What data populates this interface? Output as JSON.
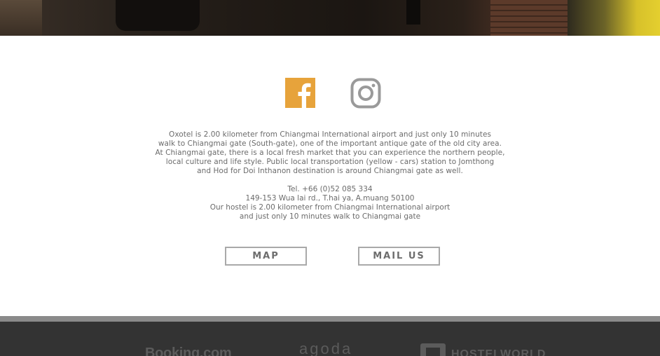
{
  "social": {
    "facebook_icon": "facebook-icon",
    "instagram_icon": "instagram-icon",
    "brand_color": "#e7a33b",
    "instagram_color": "#9a9a9a"
  },
  "description": {
    "lines": [
      "Oxotel is 2.00 kilometer from Chiangmai International airport and just only 10 minutes",
      "walk to Chiangmai gate (South-gate), one of the important antique gate of the old city area.",
      "At Chiangmai gate, there is a local fresh market that you can experience the northern people,",
      "local culture and life style. Public local transportation (yellow - cars) station to Jomthong",
      "and Hod for Doi Inthanon destination is around Chiangmai gate as well."
    ]
  },
  "contact": {
    "tel": "Tel. +66 (0)52 085 334",
    "address": "149-153 Wua lai rd., T.hai ya, A.muang 50100",
    "distance_line1": "Our hostel is 2.00 kilometer from Chiangmai International airport",
    "distance_line2": "and just only 10 minutes walk to Chiangmai gate"
  },
  "buttons": {
    "map_label": "MAP",
    "mail_label": "MAIL US"
  },
  "partners": {
    "booking": "Booking.com",
    "agoda": "agoda",
    "hostelworld": "HOSTELWORLD"
  }
}
